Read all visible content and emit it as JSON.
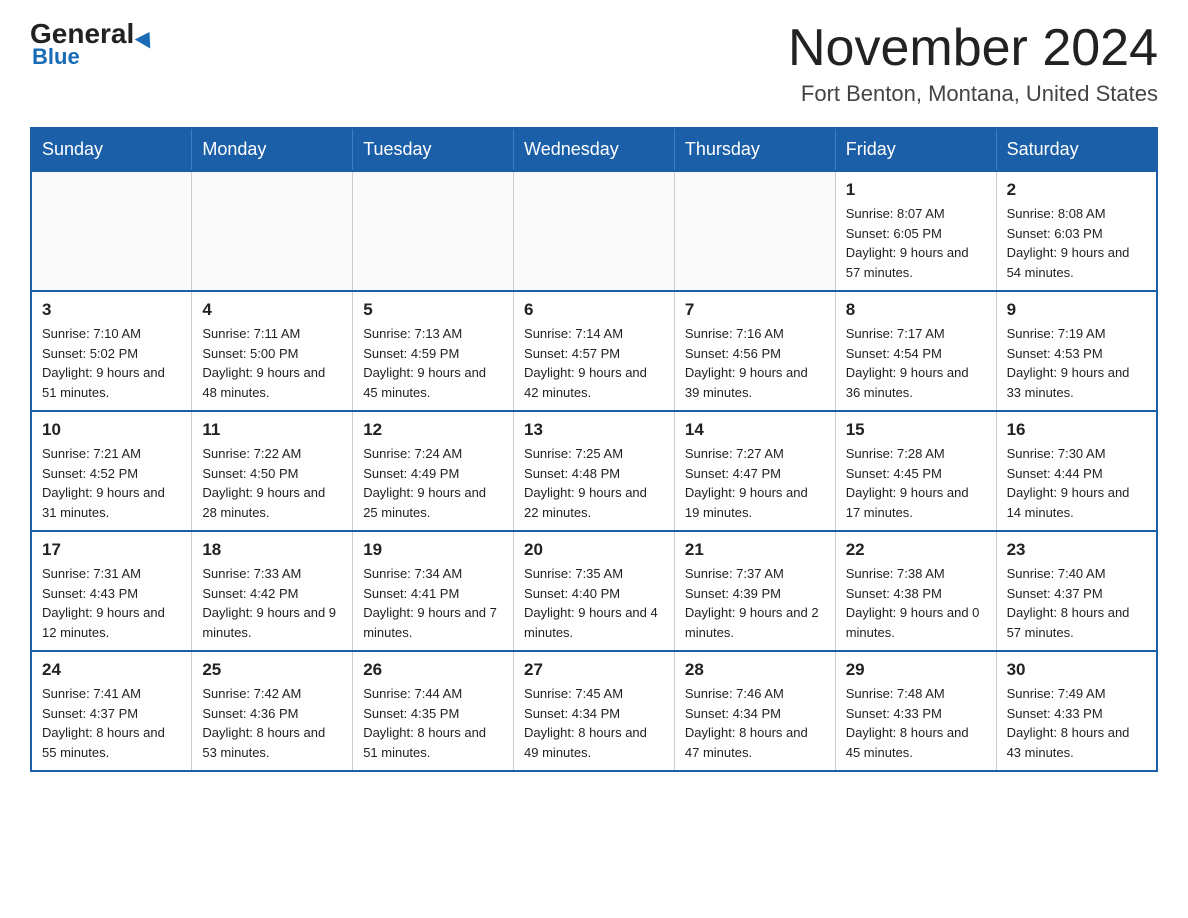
{
  "logo": {
    "part1": "General",
    "part2": "Blue"
  },
  "title": "November 2024",
  "location": "Fort Benton, Montana, United States",
  "days_of_week": [
    "Sunday",
    "Monday",
    "Tuesday",
    "Wednesday",
    "Thursday",
    "Friday",
    "Saturday"
  ],
  "weeks": [
    [
      {
        "day": "",
        "info": ""
      },
      {
        "day": "",
        "info": ""
      },
      {
        "day": "",
        "info": ""
      },
      {
        "day": "",
        "info": ""
      },
      {
        "day": "",
        "info": ""
      },
      {
        "day": "1",
        "info": "Sunrise: 8:07 AM\nSunset: 6:05 PM\nDaylight: 9 hours and 57 minutes."
      },
      {
        "day": "2",
        "info": "Sunrise: 8:08 AM\nSunset: 6:03 PM\nDaylight: 9 hours and 54 minutes."
      }
    ],
    [
      {
        "day": "3",
        "info": "Sunrise: 7:10 AM\nSunset: 5:02 PM\nDaylight: 9 hours and 51 minutes."
      },
      {
        "day": "4",
        "info": "Sunrise: 7:11 AM\nSunset: 5:00 PM\nDaylight: 9 hours and 48 minutes."
      },
      {
        "day": "5",
        "info": "Sunrise: 7:13 AM\nSunset: 4:59 PM\nDaylight: 9 hours and 45 minutes."
      },
      {
        "day": "6",
        "info": "Sunrise: 7:14 AM\nSunset: 4:57 PM\nDaylight: 9 hours and 42 minutes."
      },
      {
        "day": "7",
        "info": "Sunrise: 7:16 AM\nSunset: 4:56 PM\nDaylight: 9 hours and 39 minutes."
      },
      {
        "day": "8",
        "info": "Sunrise: 7:17 AM\nSunset: 4:54 PM\nDaylight: 9 hours and 36 minutes."
      },
      {
        "day": "9",
        "info": "Sunrise: 7:19 AM\nSunset: 4:53 PM\nDaylight: 9 hours and 33 minutes."
      }
    ],
    [
      {
        "day": "10",
        "info": "Sunrise: 7:21 AM\nSunset: 4:52 PM\nDaylight: 9 hours and 31 minutes."
      },
      {
        "day": "11",
        "info": "Sunrise: 7:22 AM\nSunset: 4:50 PM\nDaylight: 9 hours and 28 minutes."
      },
      {
        "day": "12",
        "info": "Sunrise: 7:24 AM\nSunset: 4:49 PM\nDaylight: 9 hours and 25 minutes."
      },
      {
        "day": "13",
        "info": "Sunrise: 7:25 AM\nSunset: 4:48 PM\nDaylight: 9 hours and 22 minutes."
      },
      {
        "day": "14",
        "info": "Sunrise: 7:27 AM\nSunset: 4:47 PM\nDaylight: 9 hours and 19 minutes."
      },
      {
        "day": "15",
        "info": "Sunrise: 7:28 AM\nSunset: 4:45 PM\nDaylight: 9 hours and 17 minutes."
      },
      {
        "day": "16",
        "info": "Sunrise: 7:30 AM\nSunset: 4:44 PM\nDaylight: 9 hours and 14 minutes."
      }
    ],
    [
      {
        "day": "17",
        "info": "Sunrise: 7:31 AM\nSunset: 4:43 PM\nDaylight: 9 hours and 12 minutes."
      },
      {
        "day": "18",
        "info": "Sunrise: 7:33 AM\nSunset: 4:42 PM\nDaylight: 9 hours and 9 minutes."
      },
      {
        "day": "19",
        "info": "Sunrise: 7:34 AM\nSunset: 4:41 PM\nDaylight: 9 hours and 7 minutes."
      },
      {
        "day": "20",
        "info": "Sunrise: 7:35 AM\nSunset: 4:40 PM\nDaylight: 9 hours and 4 minutes."
      },
      {
        "day": "21",
        "info": "Sunrise: 7:37 AM\nSunset: 4:39 PM\nDaylight: 9 hours and 2 minutes."
      },
      {
        "day": "22",
        "info": "Sunrise: 7:38 AM\nSunset: 4:38 PM\nDaylight: 9 hours and 0 minutes."
      },
      {
        "day": "23",
        "info": "Sunrise: 7:40 AM\nSunset: 4:37 PM\nDaylight: 8 hours and 57 minutes."
      }
    ],
    [
      {
        "day": "24",
        "info": "Sunrise: 7:41 AM\nSunset: 4:37 PM\nDaylight: 8 hours and 55 minutes."
      },
      {
        "day": "25",
        "info": "Sunrise: 7:42 AM\nSunset: 4:36 PM\nDaylight: 8 hours and 53 minutes."
      },
      {
        "day": "26",
        "info": "Sunrise: 7:44 AM\nSunset: 4:35 PM\nDaylight: 8 hours and 51 minutes."
      },
      {
        "day": "27",
        "info": "Sunrise: 7:45 AM\nSunset: 4:34 PM\nDaylight: 8 hours and 49 minutes."
      },
      {
        "day": "28",
        "info": "Sunrise: 7:46 AM\nSunset: 4:34 PM\nDaylight: 8 hours and 47 minutes."
      },
      {
        "day": "29",
        "info": "Sunrise: 7:48 AM\nSunset: 4:33 PM\nDaylight: 8 hours and 45 minutes."
      },
      {
        "day": "30",
        "info": "Sunrise: 7:49 AM\nSunset: 4:33 PM\nDaylight: 8 hours and 43 minutes."
      }
    ]
  ]
}
